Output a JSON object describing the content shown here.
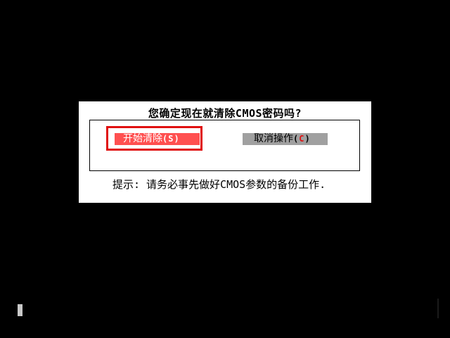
{
  "dialog": {
    "question": "您确定现在就清除CMOS密码吗?",
    "start_button": {
      "label": "开始清除",
      "hotkey_open": "(",
      "hotkey_letter": "S",
      "hotkey_close": ")"
    },
    "cancel_button": {
      "label": "取消操作",
      "hotkey_open": "(",
      "hotkey_letter": "C",
      "hotkey_close": ")"
    },
    "hint": "提示: 请务必事先做好CMOS参数的备份工作."
  },
  "colors": {
    "background": "#000000",
    "dialog_background": "#ffffff",
    "focus_outline": "#e01010",
    "start_button_bg": "#ff5050",
    "cancel_button_bg": "#a0a0a0",
    "hotkey_accent": "#e01010"
  }
}
